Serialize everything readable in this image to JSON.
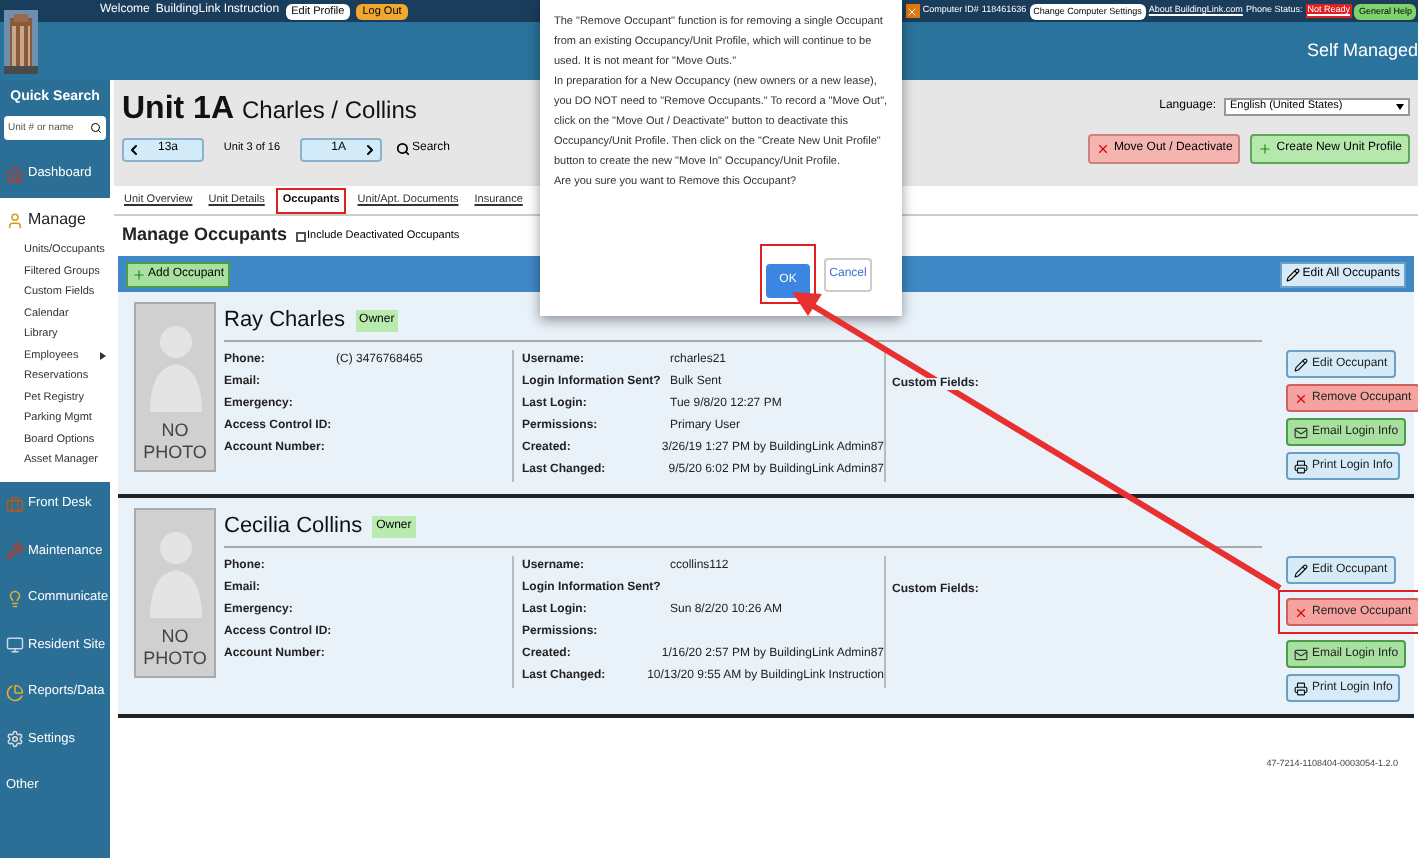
{
  "top_bar": {
    "welcome": "Welcome",
    "user": "BuildingLink Instruction",
    "edit_profile": "Edit Profile",
    "log_out": "Log Out",
    "computer_label": "Computer ID#",
    "computer_id": "118461636",
    "change_settings": "Change Computer Settings",
    "about": "About BuildingLink.com",
    "phone_label": "Phone Status:",
    "phone_status": "Not Ready",
    "help": "General Help"
  },
  "banner": {
    "title": "Self Managed"
  },
  "sidebar": {
    "quick_search": {
      "label": "Quick Search",
      "placeholder": "Unit # or name"
    },
    "sections": [
      {
        "label": "Dashboard",
        "kind": "nav"
      },
      {
        "label": "Manage",
        "kind": "group",
        "items": [
          {
            "label": "Units/Occupants",
            "has_submenu": false
          },
          {
            "label": "Filtered Groups",
            "has_submenu": false
          },
          {
            "label": "Custom Fields",
            "has_submenu": false
          },
          {
            "label": "Calendar",
            "has_submenu": false
          },
          {
            "label": "Library",
            "has_submenu": false
          },
          {
            "label": "Employees",
            "has_submenu": true
          },
          {
            "label": "Reservations",
            "has_submenu": false
          },
          {
            "label": "Pet Registry",
            "has_submenu": false
          },
          {
            "label": "Parking Mgmt",
            "has_submenu": false
          },
          {
            "label": "Board Options",
            "has_submenu": false
          },
          {
            "label": "Asset Manager",
            "has_submenu": false
          }
        ]
      },
      {
        "label": "Front Desk",
        "kind": "nav"
      },
      {
        "label": "Maintenance",
        "kind": "nav"
      },
      {
        "label": "Communicate",
        "kind": "nav"
      },
      {
        "label": "Resident Site",
        "kind": "nav"
      },
      {
        "label": "Reports/Data",
        "kind": "nav"
      },
      {
        "label": "Settings",
        "kind": "nav"
      },
      {
        "label": "Other",
        "kind": "nav"
      }
    ]
  },
  "header": {
    "unit": "Unit 1A",
    "names": "Charles / Collins",
    "prev": "13a",
    "position": "Unit 3 of 16",
    "current": "1A",
    "search": "Search",
    "language_label": "Language:",
    "language": "English (United States)",
    "move_out": "Move Out / Deactivate",
    "create": "Create New Unit Profile"
  },
  "tabs": [
    {
      "label": "Unit Overview",
      "selected": false,
      "highlighted": false
    },
    {
      "label": "Unit Details",
      "selected": false,
      "highlighted": false
    },
    {
      "label": "Occupants",
      "selected": true,
      "highlighted": true
    },
    {
      "label": "Unit/Apt. Documents",
      "selected": false,
      "highlighted": false
    },
    {
      "label": "Insurance",
      "selected": false,
      "highlighted": false
    }
  ],
  "manage": {
    "title": "Manage Occupants",
    "include_deactivated": {
      "label": "Include Deactivated Occupants",
      "checked": false
    }
  },
  "toolbar": {
    "add": "Add Occupant",
    "edit_all": "Edit All Occupants"
  },
  "occupants": [
    {
      "name": "Ray Charles",
      "role": "Owner",
      "photo_label": "NO PHOTO",
      "custom_fields_label": "Custom Fields:",
      "contact": [
        {
          "label": "Phone:",
          "value": "(C) 3476768465"
        },
        {
          "label": "Email:"
        },
        {
          "label": "Emergency:"
        },
        {
          "label": "Access Control ID:"
        },
        {
          "label": "Account Number:"
        }
      ],
      "account": [
        {
          "label": "Username:",
          "value": "rcharles21"
        },
        {
          "label": "Login Information Sent?",
          "value": "Bulk Sent"
        },
        {
          "label": "Last Login:",
          "value": "Tue 9/8/20 12:27 PM"
        },
        {
          "label": "Permissions:",
          "value": "Primary User"
        },
        {
          "label": "Created:",
          "value": "3/26/19 1:27 PM by BuildingLink Admin87"
        },
        {
          "label": "Last Changed:",
          "value": "9/5/20 6:02 PM by BuildingLink Admin87"
        }
      ],
      "actions": [
        {
          "kind": "edit",
          "label": "Edit Occupant",
          "highlighted": false
        },
        {
          "kind": "remove",
          "label": "Remove Occupant",
          "highlighted": false
        },
        {
          "kind": "email",
          "label": "Email Login Info",
          "highlighted": false
        },
        {
          "kind": "print",
          "label": "Print Login Info",
          "highlighted": false
        }
      ]
    },
    {
      "name": "Cecilia Collins",
      "role": "Owner",
      "photo_label": "NO PHOTO",
      "custom_fields_label": "Custom Fields:",
      "contact": [
        {
          "label": "Phone:"
        },
        {
          "label": "Email:"
        },
        {
          "label": "Emergency:"
        },
        {
          "label": "Access Control ID:"
        },
        {
          "label": "Account Number:"
        }
      ],
      "account": [
        {
          "label": "Username:",
          "value": "ccollins112"
        },
        {
          "label": "Login Information Sent?"
        },
        {
          "label": "Last Login:",
          "value": "Sun 8/2/20 10:26 AM"
        },
        {
          "label": "Permissions:"
        },
        {
          "label": "Created:",
          "value": "1/16/20 2:57 PM by BuildingLink Admin87"
        },
        {
          "label": "Last Changed:",
          "value": "10/13/20 9:55 AM by BuildingLink Instruction"
        }
      ],
      "actions": [
        {
          "kind": "edit",
          "label": "Edit Occupant",
          "highlighted": false
        },
        {
          "kind": "remove",
          "label": "Remove Occupant",
          "highlighted": true
        },
        {
          "kind": "email",
          "label": "Email Login Info",
          "highlighted": false
        },
        {
          "kind": "print",
          "label": "Print Login Info",
          "highlighted": false
        }
      ]
    }
  ],
  "footer": {
    "version": "47-7214-1108404-0003054-1.2.0"
  },
  "dialog": {
    "paragraphs": [
      "The \"Remove Occupant\" function is for removing a single Occupant from an existing Occupancy/Unit Profile, which will continue to be used. It is not meant for \"Move Outs.\"",
      "In preparation for a New Occupancy (new owners or a new lease), you DO NOT need to \"Remove Occupants.\" To record a \"Move Out\", click on the \"Move Out / Deactivate\" button to deactivate this Occupancy/Unit Profile. Then click on the \"Create New Unit Profile\" button to create the new \"Move In\" Occupancy/Unit Profile.",
      "Are you sure you want to Remove this Occupant?"
    ],
    "ok": "OK",
    "ok_highlighted": true,
    "cancel": "Cancel"
  }
}
